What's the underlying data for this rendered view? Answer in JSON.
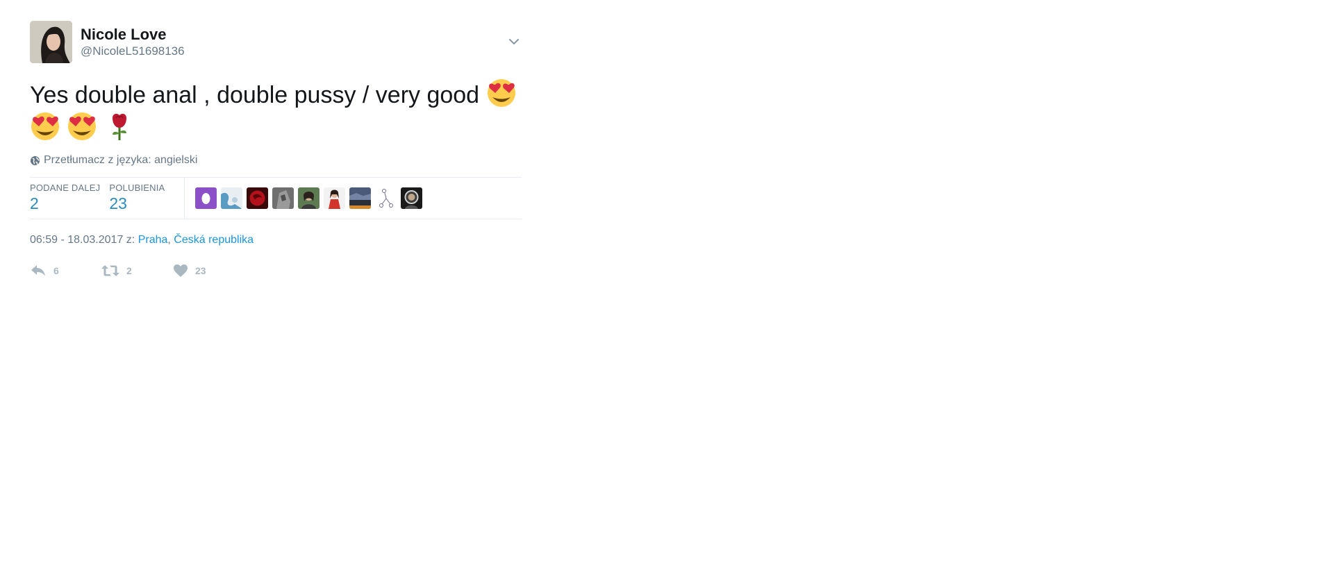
{
  "author": {
    "name": "Nicole Love",
    "handle": "@NicoleL51698136"
  },
  "tweet": {
    "text": "Yes double anal , double pussy / very good",
    "emojis": [
      "heart-eyes-emoji",
      "heart-eyes-emoji",
      "heart-eyes-emoji",
      "rose-emoji"
    ]
  },
  "translate": {
    "label": "Przetłumacz z języka: angielski"
  },
  "stats": {
    "retweets_label": "PODANE DALEJ",
    "retweets_value": "2",
    "likes_label": "POLUBIENIA",
    "likes_value": "23"
  },
  "meta": {
    "timestamp": "06:59 - 18.03.2017 z:",
    "location_city": "Praha",
    "separator": ",",
    "location_country": "Česká republika"
  },
  "actions": {
    "reply_count": "6",
    "retweet_count": "2",
    "like_count": "23"
  },
  "colors": {
    "link": "#1b95e0",
    "secondary_text": "#657786",
    "action_gray": "#aab8c2",
    "border": "#e6ecf0"
  }
}
